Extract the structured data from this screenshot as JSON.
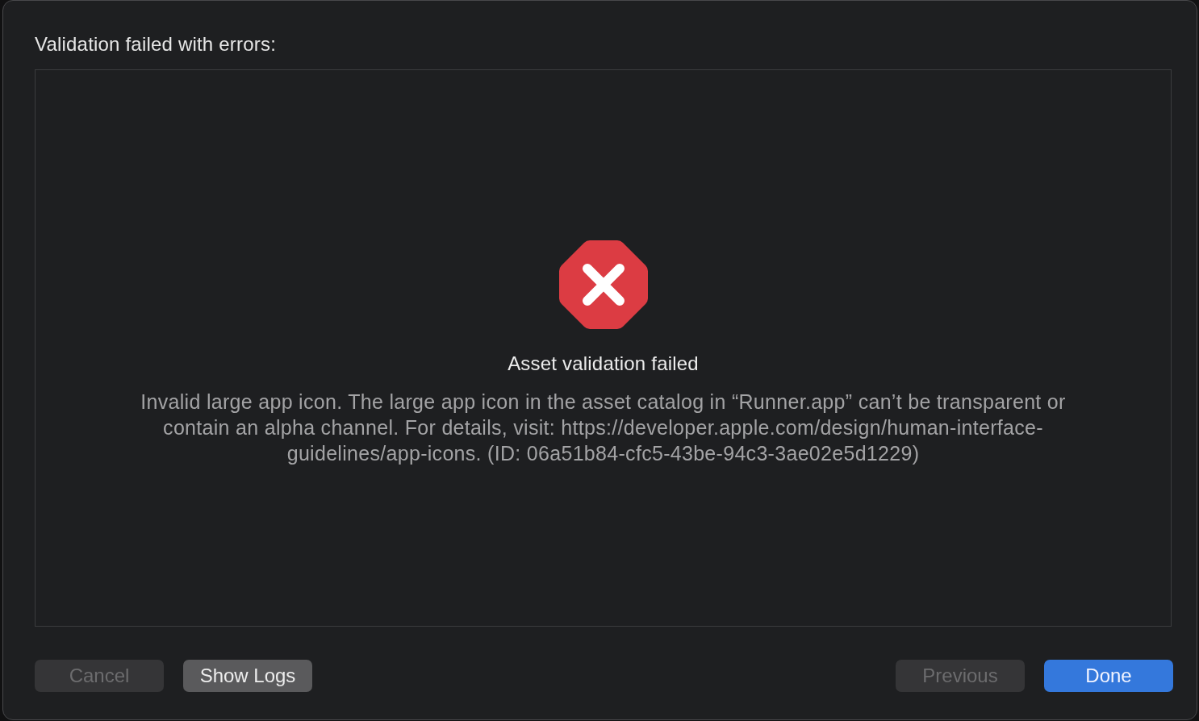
{
  "sheet": {
    "title": "Validation failed with errors:"
  },
  "result": {
    "heading": "Asset validation failed",
    "message": "Invalid large app icon. The large app icon in the asset catalog in “Runner.app” can’t be transparent or contain an alpha channel. For details, visit: https://developer.apple.com/design/human-interface-guidelines/app-icons. (ID: 06a51b84-cfc5-43be-94c3-3ae02e5d1229)"
  },
  "footer": {
    "left_buttons": [
      {
        "label": "Cancel",
        "disabled": true,
        "default": false
      },
      {
        "label": "Show Logs",
        "disabled": false,
        "default": false
      }
    ],
    "right_buttons": [
      {
        "label": "Previous",
        "disabled": true,
        "default": false
      },
      {
        "label": "Done",
        "disabled": false,
        "default": true
      }
    ]
  }
}
